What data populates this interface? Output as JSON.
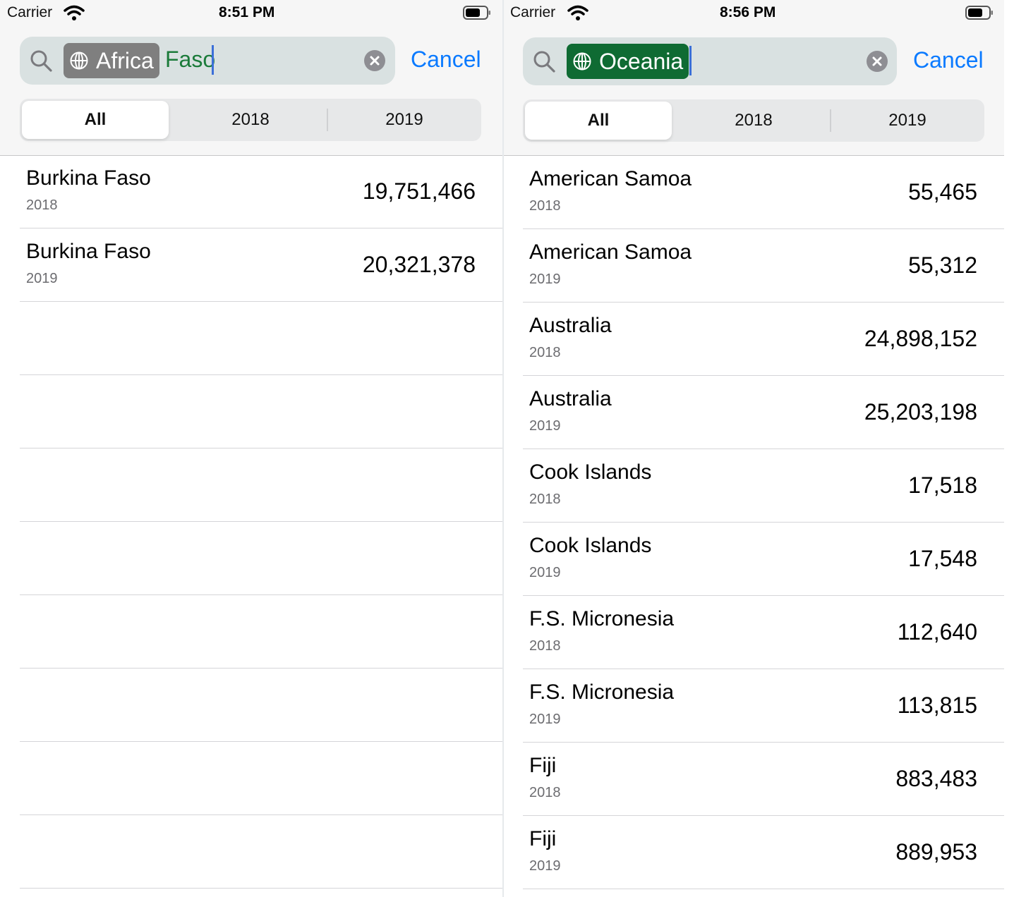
{
  "left_screen": {
    "status": {
      "carrier": "Carrier",
      "time": "8:51 PM"
    },
    "search": {
      "token_label": "Africa",
      "token_color": "#7f7f7f",
      "typed_text": "Faso",
      "token_icon": "globe-icon",
      "cancel_label": "Cancel"
    },
    "scope": {
      "options": [
        "All",
        "2018",
        "2019"
      ],
      "selected": "All"
    },
    "rows": [
      {
        "name": "Burkina Faso",
        "year": "2018",
        "value": "19,751,466"
      },
      {
        "name": "Burkina Faso",
        "year": "2019",
        "value": "20,321,378"
      }
    ],
    "empty_row_count": 8
  },
  "right_screen": {
    "status": {
      "carrier": "Carrier",
      "time": "8:56 PM"
    },
    "search": {
      "token_label": "Oceania",
      "token_color": "#0f6b33",
      "typed_text": "",
      "token_icon": "globe-icon",
      "cancel_label": "Cancel"
    },
    "scope": {
      "options": [
        "All",
        "2018",
        "2019"
      ],
      "selected": "All"
    },
    "rows": [
      {
        "name": "American Samoa",
        "year": "2018",
        "value": "55,465"
      },
      {
        "name": "American Samoa",
        "year": "2019",
        "value": "55,312"
      },
      {
        "name": "Australia",
        "year": "2018",
        "value": "24,898,152"
      },
      {
        "name": "Australia",
        "year": "2019",
        "value": "25,203,198"
      },
      {
        "name": "Cook Islands",
        "year": "2018",
        "value": "17,518"
      },
      {
        "name": "Cook Islands",
        "year": "2019",
        "value": "17,548"
      },
      {
        "name": "F.S. Micronesia",
        "year": "2018",
        "value": "112,640"
      },
      {
        "name": "F.S. Micronesia",
        "year": "2019",
        "value": "113,815"
      },
      {
        "name": "Fiji",
        "year": "2018",
        "value": "883,483"
      },
      {
        "name": "Fiji",
        "year": "2019",
        "value": "889,953"
      }
    ],
    "empty_row_count": 0
  }
}
